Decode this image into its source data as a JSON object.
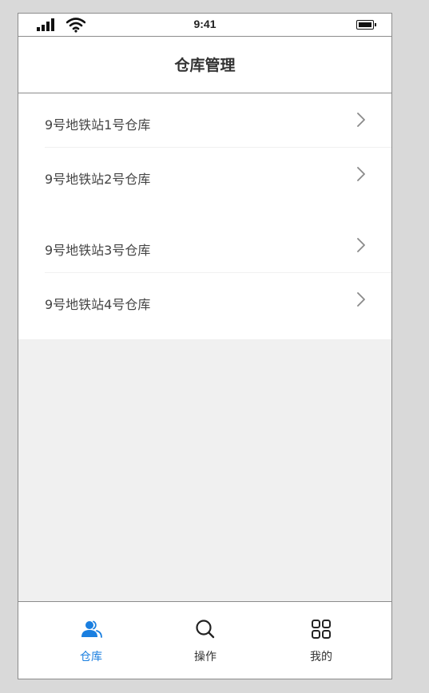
{
  "status_bar": {
    "time": "9:41"
  },
  "nav": {
    "title": "仓库管理"
  },
  "warehouses": [
    {
      "label": "9号地铁站1号仓库"
    },
    {
      "label": "9号地铁站2号仓库"
    },
    {
      "label": "9号地铁站3号仓库"
    },
    {
      "label": "9号地铁站4号仓库"
    }
  ],
  "tabs": [
    {
      "label": "仓库",
      "icon": "users-icon",
      "active": true
    },
    {
      "label": "操作",
      "icon": "search-icon",
      "active": false
    },
    {
      "label": "我的",
      "icon": "grid-icon",
      "active": false
    }
  ],
  "colors": {
    "accent": "#1a7fe0",
    "background": "#f0f0f0"
  }
}
